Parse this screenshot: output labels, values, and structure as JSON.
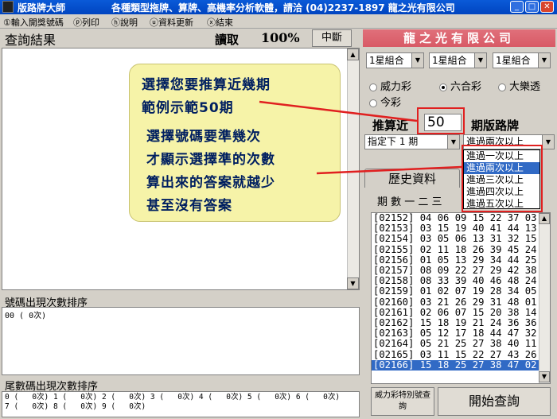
{
  "window": {
    "app_title": "版路牌大師",
    "title": "各種類型拖牌、算牌、高機率分析軟體，請洽 (04)2237-1897 龍之光有限公司"
  },
  "menu": [
    "①輸入開獎號碼",
    "ⓟ列印",
    "ⓗ說明",
    "ⓤ資料更新",
    "ⓧ結束"
  ],
  "left": {
    "results_title": "查詢結果",
    "reading_label": "讀取",
    "percent": "100%",
    "stop_label": "中斷",
    "freq_title": "號碼出現次數排序",
    "freq_text": "00 (  0次)",
    "tail_title": "尾數碼出現次數排序",
    "tail_line1": "0 (   0次) 1 (   0次) 2 (   0次) 3 (   0次) 4 (   0次) 5 (   0次) 6 (   0次)",
    "tail_line2": "7 (   0次) 8 (   0次) 9 (   0次)"
  },
  "right": {
    "company": "龍之光有限公司",
    "combos": [
      "1星組合",
      "1星組合",
      "1星組合"
    ],
    "radio_power": "威力彩",
    "radio_six": "六合彩",
    "radio_lotto": "大樂透",
    "radio_today": "今彩",
    "calc_label": "推算近",
    "recent_value": "50",
    "mode_label": "期版路牌",
    "specify_value": "指定下 1 期",
    "pass_value": "進過兩次以上",
    "options": [
      "進過一次以上",
      "進過兩次以上",
      "進過三次以上",
      "進過四次以上",
      "進過五次以上"
    ],
    "history_tab": "歷史資料",
    "history_header": "期 數  一 二 三",
    "history": [
      "[02152] 04 06 09 15 22 37 03",
      "[02153] 03 15 19 40 41 44 13",
      "[02154] 03 05 06 13 31 32 15",
      "[02155] 02 11 18 26 39 45 24",
      "[02156] 01 05 13 29 34 44 25",
      "[02157] 08 09 22 27 29 42 38",
      "[02158] 08 33 39 40 46 48 24",
      "[02159] 01 02 07 19 28 34 05",
      "[02160] 03 21 26 29 31 48 01",
      "[02161] 02 06 07 15 20 38 14",
      "[02162] 15 18 19 21 24 36 36",
      "[02163] 05 12 17 18 44 47 32",
      "[02164] 05 21 25 27 38 40 11",
      "[02165] 03 11 15 22 27 43 26",
      "[02166] 15 18 25 27 38 47 02"
    ],
    "special_label": "威力彩特別號查詢",
    "query_label": "開始查詢"
  },
  "notes": {
    "line1": "選擇您要推算近幾期",
    "line2": "範例示範50期",
    "line3": "選擇號碼要準幾次",
    "line4": "才顯示選擇準的次數",
    "line5": "算出來的答案就越少",
    "line6": "甚至沒有答案"
  }
}
